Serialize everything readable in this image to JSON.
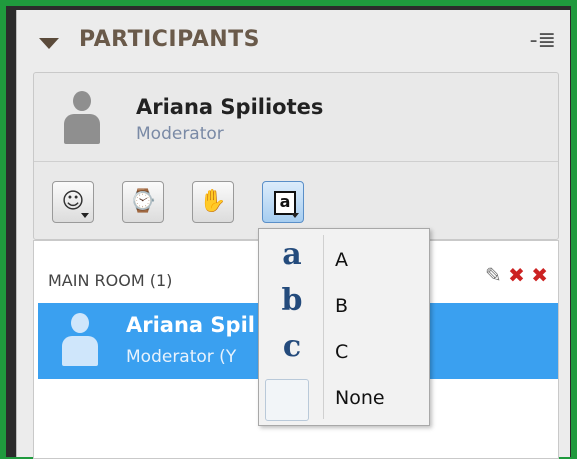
{
  "panel": {
    "title": "PARTICIPANTS",
    "menu_icon": "menu-lines-icon"
  },
  "self": {
    "name": "Ariana Spiliotes",
    "role": "Moderator"
  },
  "toolbar": [
    {
      "name": "emoticon-button",
      "icon": "smiley-icon",
      "glyph": "☺"
    },
    {
      "name": "status-button",
      "icon": "person-clock-icon",
      "glyph": "⌚"
    },
    {
      "name": "raise-hand-button",
      "icon": "hand-icon",
      "glyph": "✋"
    },
    {
      "name": "answer-button",
      "icon": "letter-a-icon",
      "glyph": "a"
    }
  ],
  "room": {
    "label": "MAIN ROOM (1)"
  },
  "participant": {
    "name": "Ariana Spil",
    "role": "Moderator (Y"
  },
  "dropdown": {
    "items": [
      {
        "glyph": "a",
        "label": "A"
      },
      {
        "glyph": "b",
        "label": "B"
      },
      {
        "glyph": "c",
        "label": "C"
      },
      {
        "glyph": "",
        "label": "None"
      }
    ]
  },
  "colors": {
    "accent": "#3aa0f0",
    "border": "#1f9a3d"
  }
}
